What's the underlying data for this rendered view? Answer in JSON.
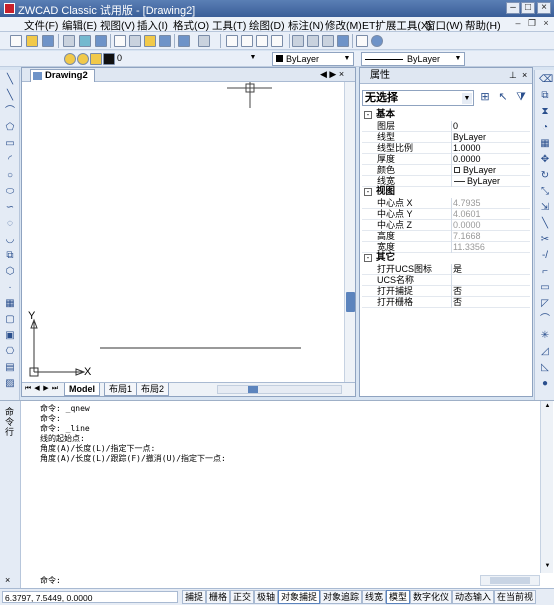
{
  "window": {
    "title": "ZWCAD Classic 试用版 - [Drawing2]"
  },
  "menu": [
    {
      "id": "file",
      "label": "文件(F)"
    },
    {
      "id": "edit",
      "label": "编辑(E)"
    },
    {
      "id": "view",
      "label": "视图(V)"
    },
    {
      "id": "insert",
      "label": "插入(I)"
    },
    {
      "id": "format",
      "label": "格式(O)"
    },
    {
      "id": "tools",
      "label": "工具(T)"
    },
    {
      "id": "draw",
      "label": "绘图(D)"
    },
    {
      "id": "dimension",
      "label": "标注(N)"
    },
    {
      "id": "modify",
      "label": "修改(M)"
    },
    {
      "id": "et-ext",
      "label": "ET扩展工具(X)"
    },
    {
      "id": "window",
      "label": "窗口(W)"
    },
    {
      "id": "help",
      "label": "帮助(H)"
    }
  ],
  "layers_toolbar": {
    "current_layer": "0",
    "color": "ByLayer",
    "linetype": "ByLayer"
  },
  "drawing": {
    "tab_label": "Drawing2",
    "layout_tabs": [
      "Model",
      "布局1",
      "布局2"
    ],
    "active_layout": "Model",
    "ucs_x": "X",
    "ucs_y": "Y"
  },
  "properties": {
    "title": "属性",
    "selection": "无选择",
    "categories": [
      {
        "name": "基本",
        "rows": [
          {
            "k": "图层",
            "v": "0"
          },
          {
            "k": "线型",
            "v": "ByLayer"
          },
          {
            "k": "线型比例",
            "v": "1.0000"
          },
          {
            "k": "厚度",
            "v": "0.0000"
          },
          {
            "k": "颜色",
            "v": "ByLayer"
          },
          {
            "k": "线宽",
            "v": "ByLayer"
          }
        ]
      },
      {
        "name": "视图",
        "rows": [
          {
            "k": "中心点 X",
            "v": "4.7935"
          },
          {
            "k": "中心点 Y",
            "v": "4.0601"
          },
          {
            "k": "中心点 Z",
            "v": "0.0000"
          },
          {
            "k": "高度",
            "v": "7.1668"
          },
          {
            "k": "宽度",
            "v": "11.3356"
          }
        ]
      },
      {
        "name": "其它",
        "rows": [
          {
            "k": "打开UCS图标",
            "v": "是"
          },
          {
            "k": "UCS名称",
            "v": ""
          },
          {
            "k": "打开捕捉",
            "v": "否"
          },
          {
            "k": "打开栅格",
            "v": "否"
          }
        ]
      }
    ]
  },
  "command": {
    "side_label": "命令行",
    "history": [
      "命令: _qnew",
      "命令:",
      "命令: _line",
      "线的起始点:",
      "角度(A)/长度(L)/指定下一点:",
      "角度(A)/长度(L)/跟踪(F)/撤消(U)/指定下一点:"
    ],
    "prompt": "命令:"
  },
  "status": {
    "coords": "6.3797,  7.5449,  0.0000",
    "buttons": [
      {
        "label": "捕捉",
        "on": false
      },
      {
        "label": "栅格",
        "on": false
      },
      {
        "label": "正交",
        "on": false
      },
      {
        "label": "极轴",
        "on": false
      },
      {
        "label": "对象捕捉",
        "on": true
      },
      {
        "label": "对象追踪",
        "on": false
      },
      {
        "label": "线宽",
        "on": false
      },
      {
        "label": "模型",
        "on": true
      },
      {
        "label": "数字化仪",
        "on": false
      },
      {
        "label": "动态输入",
        "on": false
      },
      {
        "label": "在当前视",
        "on": false
      }
    ]
  }
}
